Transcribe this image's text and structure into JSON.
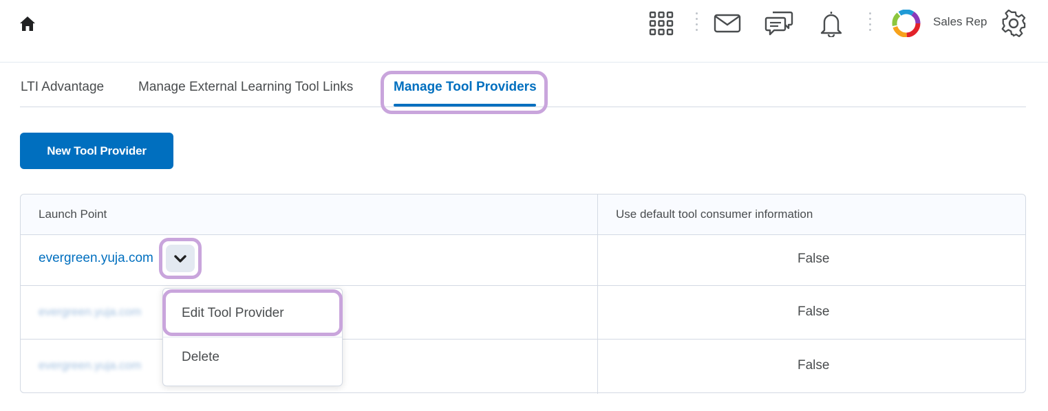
{
  "navbar": {
    "icons": {
      "home": "home-icon",
      "apps": "grid-icon",
      "mail": "mail-icon",
      "chat": "chat-icon",
      "notifications": "bell-icon",
      "avatar": "avatar-logo",
      "settings": "gear-icon"
    },
    "user_name": "Sales Rep"
  },
  "tabs": [
    {
      "label": "LTI Advantage",
      "active": false
    },
    {
      "label": "Manage External Learning Tool Links",
      "active": false
    },
    {
      "label": "Manage Tool Providers",
      "active": true
    }
  ],
  "actions": {
    "new_provider_label": "New Tool Provider"
  },
  "table": {
    "headers": [
      "Launch Point",
      "Use default tool consumer information"
    ],
    "rows": [
      {
        "launch_point": "evergreen.yuja.com",
        "use_default": "False",
        "blurred": false
      },
      {
        "launch_point": "evergreen.yuja.com",
        "use_default": "False",
        "blurred": true
      },
      {
        "launch_point": "evergreen.yuja.com",
        "use_default": "False",
        "blurred": true
      }
    ]
  },
  "context_menu": {
    "items": [
      "Edit Tool Provider",
      "Delete"
    ]
  },
  "colors": {
    "accent": "#006fbf",
    "highlight": "#c9a5dc",
    "border": "#d3d9e3",
    "text": "#494c4e"
  }
}
